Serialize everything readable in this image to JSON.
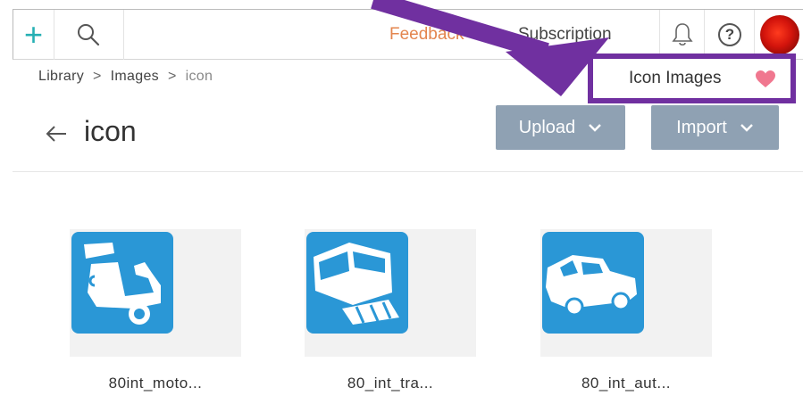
{
  "topbar": {
    "feedback_label": "Feedback",
    "subscription_label": "Subscription"
  },
  "breadcrumb": {
    "items": [
      "Library",
      "Images",
      "icon"
    ]
  },
  "collection": {
    "label": "Icon Images"
  },
  "folder": {
    "title": "icon",
    "upload_label": "Upload",
    "import_label": "Import"
  },
  "files": [
    {
      "name": "80int_moto...",
      "icon": "scooter-icon"
    },
    {
      "name": "80_int_tra...",
      "icon": "train-icon"
    },
    {
      "name": "80_int_aut...",
      "icon": "car-icon"
    }
  ],
  "colors": {
    "accent_teal": "#26b0b4",
    "feedback_orange": "#e3854e",
    "button_gray": "#8fa1b3",
    "icon_blue": "#2a97d6",
    "annotation_purple": "#7030a0",
    "heart_pink": "#f0778f"
  }
}
